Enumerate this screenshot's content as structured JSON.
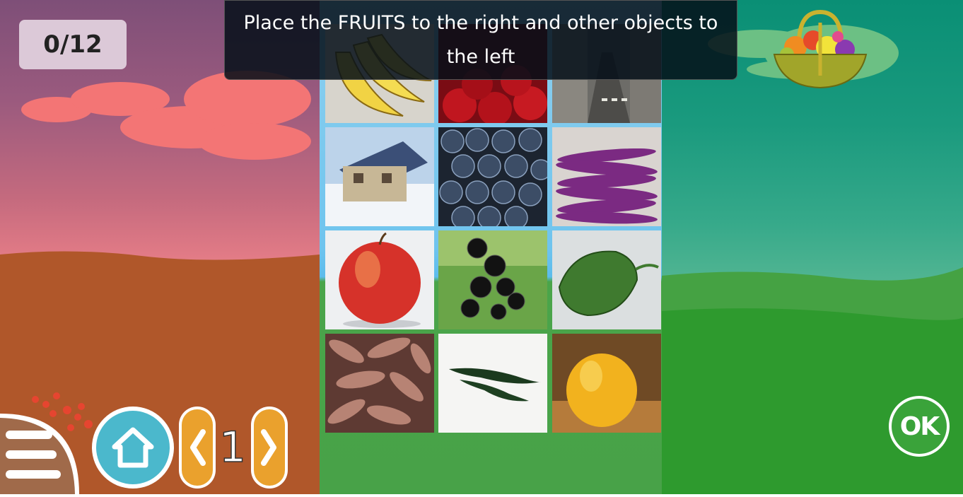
{
  "score": "0/12",
  "instruction": "Place the FRUITS to the right and other objects to the left",
  "level": "1",
  "ok_label": "OK",
  "tiles": [
    {
      "name": "banana",
      "label": "banana"
    },
    {
      "name": "cherries",
      "label": "cherries"
    },
    {
      "name": "street",
      "label": "street"
    },
    {
      "name": "house",
      "label": "house"
    },
    {
      "name": "blueberries",
      "label": "blueberries"
    },
    {
      "name": "eggplants",
      "label": "eggplants"
    },
    {
      "name": "apple",
      "label": "apple"
    },
    {
      "name": "blackcurrants",
      "label": "blackcurrants"
    },
    {
      "name": "bitter-gourd",
      "label": "bitter gourd"
    },
    {
      "name": "sweet-potatoes",
      "label": "sweet potatoes"
    },
    {
      "name": "chili-peppers",
      "label": "chili peppers"
    },
    {
      "name": "apricot",
      "label": "apricot"
    }
  ],
  "colors": {
    "accent_orange": "#eaa12d",
    "home_blue": "#4bb8cc",
    "ok_green": "#3aa33a",
    "left_ground": "#b0572a",
    "right_ground": "#2e9a2e"
  },
  "icons": [
    "menu-icon",
    "home-icon",
    "chevron-left-icon",
    "chevron-right-icon",
    "basket-icon"
  ]
}
